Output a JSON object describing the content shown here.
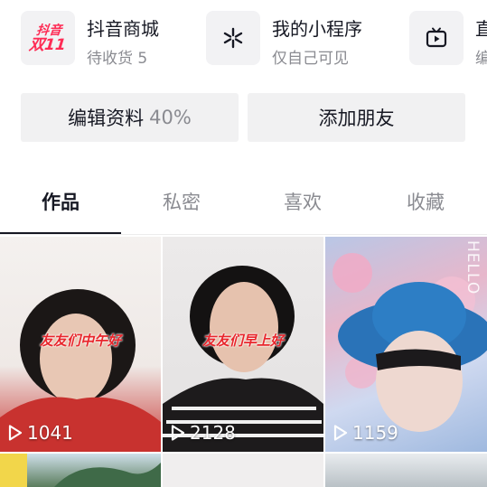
{
  "services": [
    {
      "title": "抖音商城",
      "subtitle": "待收货 5",
      "icon": "double-11-logo-icon",
      "logo_line1": "抖音",
      "logo_line2": "双11"
    },
    {
      "title": "我的小程序",
      "subtitle": "仅自己可见",
      "icon": "mini-program-asterisk-icon"
    },
    {
      "title": "直",
      "subtitle": "编",
      "icon": "tv-play-icon"
    }
  ],
  "buttons": {
    "edit_label": "编辑资料",
    "edit_progress": "40%",
    "add_friends_label": "添加朋友"
  },
  "tabs": [
    {
      "label": "作品",
      "active": true
    },
    {
      "label": "私密",
      "active": false
    },
    {
      "label": "喜欢",
      "active": false
    },
    {
      "label": "收藏",
      "active": false
    }
  ],
  "videos": [
    {
      "plays": "1041",
      "caption": "友友们中午好"
    },
    {
      "plays": "2128",
      "caption": "友友们早上好"
    },
    {
      "plays": "1159",
      "watermark": "HELLO"
    },
    {
      "plays": null
    },
    {
      "plays": null
    },
    {
      "plays": null
    }
  ],
  "colors": {
    "accent_red": "#fe2c55",
    "text_primary": "#161823",
    "text_secondary": "#8a8b91",
    "button_bg": "#f1f1f2"
  }
}
